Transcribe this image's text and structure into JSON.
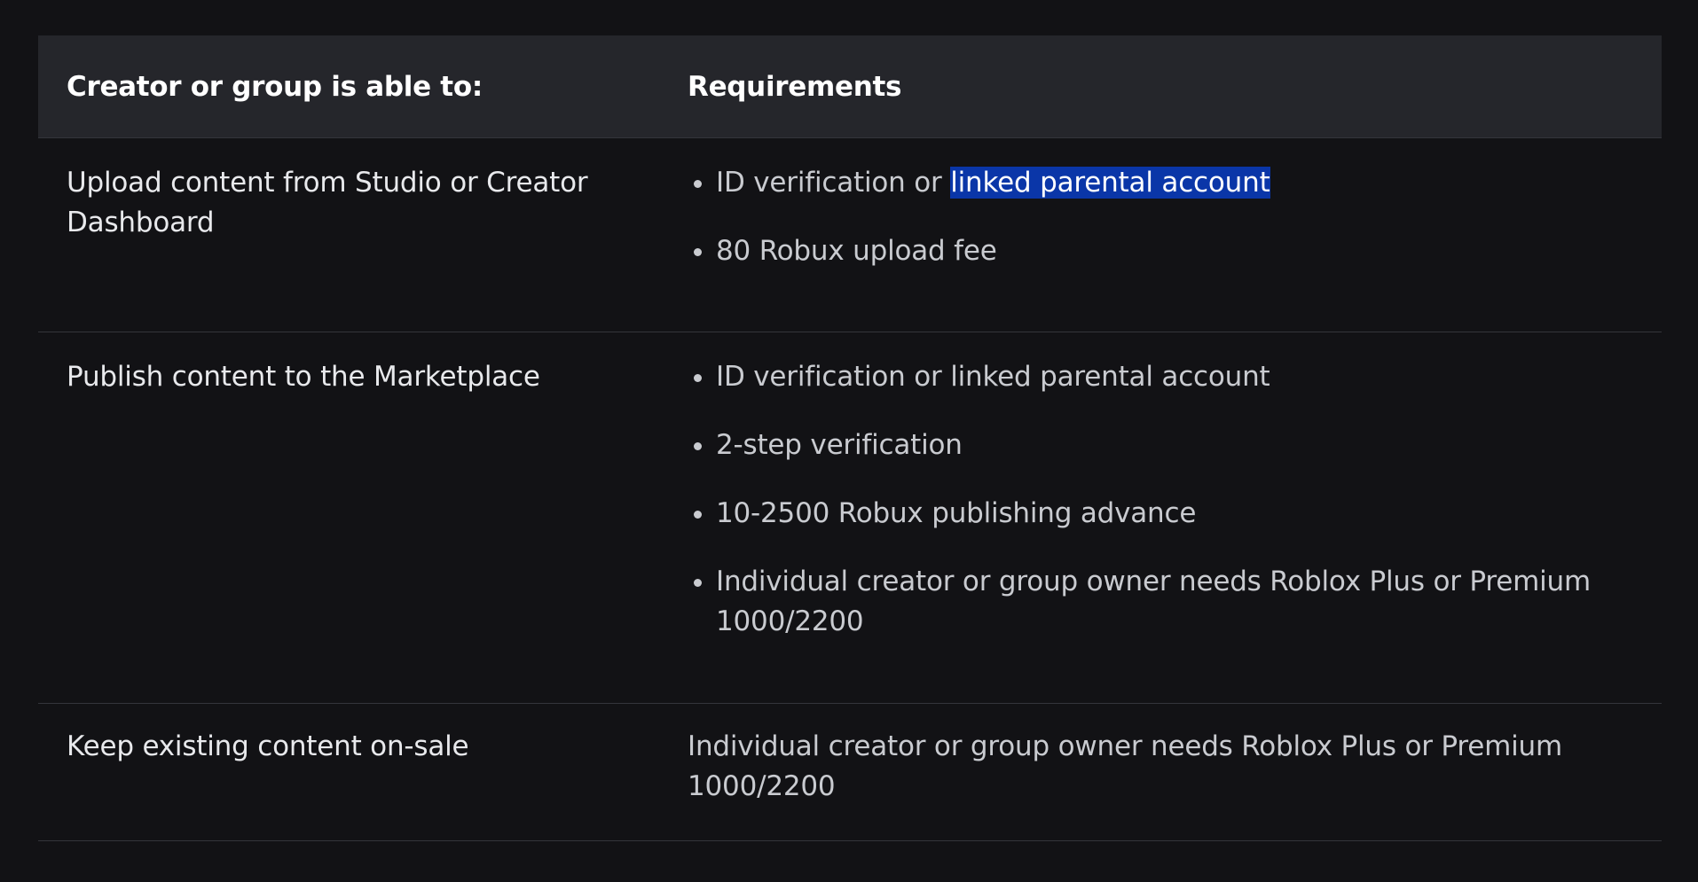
{
  "table": {
    "headers": [
      "Creator or group is able to:",
      "Requirements"
    ],
    "rows": [
      {
        "ability": "Upload content from Studio or Creator Dashboard",
        "requirements": [
          {
            "prefix": "ID verification or ",
            "link": "linked parental account"
          },
          {
            "text": "80 Robux upload fee"
          }
        ]
      },
      {
        "ability": "Publish content to the Marketplace",
        "requirements": [
          {
            "text": "ID verification or linked parental account"
          },
          {
            "text": "2-step verification"
          },
          {
            "text": "10-2500 Robux publishing advance"
          },
          {
            "text": "Individual creator or group owner needs Roblox Plus or Premium 1000/2200"
          }
        ]
      },
      {
        "ability": "Keep existing content on-sale",
        "requirement_text": "Individual creator or group owner needs Roblox Plus or Premium 1000/2200"
      }
    ]
  },
  "colors": {
    "background": "#121215",
    "header_background": "#25262b",
    "selection_highlight": "#0a36a8",
    "divider": "#34353b"
  }
}
